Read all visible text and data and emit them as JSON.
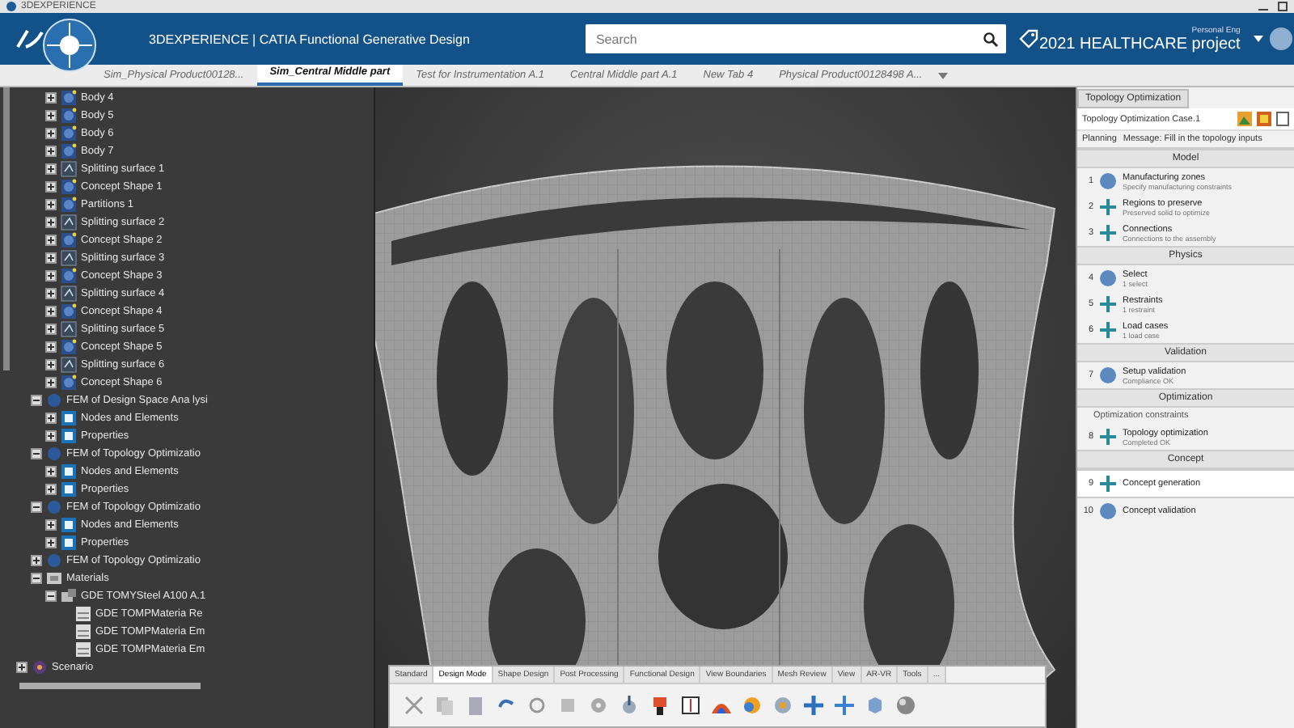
{
  "title_bar": {
    "title": "3DEXPERIENCE"
  },
  "header": {
    "app_title": "3DEXPERIENCE | CATIA Functional Generative Design",
    "search": {
      "placeholder": "Search"
    },
    "role": "Personal Eng",
    "project": "2021 HEALTHCARE project"
  },
  "tabs": [
    {
      "label": "Sim_Physical Product00128...",
      "selected": false
    },
    {
      "label": "Sim_Central Middle part",
      "selected": true
    },
    {
      "label": "Test for Instrumentation A.1",
      "selected": false
    },
    {
      "label": "Central Middle part A.1",
      "selected": false
    },
    {
      "label": "New Tab 4",
      "selected": false
    },
    {
      "label": "Physical Product00128498 A...",
      "selected": false
    }
  ],
  "tree": {
    "items": [
      {
        "children": [
          {
            "children": [
              {
                "label": "Body 4",
                "kind": "body",
                "expanded": false
              },
              {
                "label": "Body 5",
                "kind": "body",
                "expanded": false
              },
              {
                "label": "Body 6",
                "kind": "body",
                "expanded": false
              },
              {
                "label": "Body 7",
                "kind": "body",
                "expanded": false
              },
              {
                "label": "Splitting surface 1",
                "kind": "surface",
                "expanded": false
              },
              {
                "label": "Concept Shape 1",
                "kind": "body",
                "expanded": false
              },
              {
                "label": "Partitions 1",
                "kind": "body",
                "expanded": false
              },
              {
                "label": "Splitting surface 2",
                "kind": "surface",
                "expanded": false
              },
              {
                "label": "Concept Shape 2",
                "kind": "body",
                "expanded": false
              },
              {
                "label": "Splitting surface 3",
                "kind": "surface",
                "expanded": false
              },
              {
                "label": "Concept Shape 3",
                "kind": "body",
                "expanded": false
              },
              {
                "label": "Splitting surface 4",
                "kind": "surface",
                "expanded": false
              },
              {
                "label": "Concept Shape 4",
                "kind": "body",
                "expanded": false
              },
              {
                "label": "Splitting surface 5",
                "kind": "surface",
                "expanded": false
              },
              {
                "label": "Concept Shape 5",
                "kind": "body",
                "expanded": false
              },
              {
                "label": "Splitting surface 6",
                "kind": "surface",
                "expanded": false
              },
              {
                "label": "Concept Shape 6",
                "kind": "body",
                "expanded": false
              }
            ]
          },
          {
            "label": "FEM of Design Space Ana lysi",
            "kind": "fem",
            "expanded": true,
            "children": [
              {
                "label": "Nodes and Elements",
                "kind": "mesh",
                "expanded": false
              },
              {
                "label": "Properties",
                "kind": "mesh",
                "expanded": false
              }
            ]
          },
          {
            "label": "FEM of Topology Optimizatio",
            "kind": "fem",
            "expanded": true,
            "children": [
              {
                "label": "Nodes and Elements",
                "kind": "mesh",
                "expanded": false
              },
              {
                "label": "Properties",
                "kind": "mesh",
                "expanded": false
              }
            ]
          },
          {
            "label": "FEM of Topology Optimizatio",
            "kind": "fem",
            "expanded": true,
            "children": [
              {
                "label": "Nodes and Elements",
                "kind": "mesh",
                "expanded": false
              },
              {
                "label": "Properties",
                "kind": "mesh",
                "expanded": false
              }
            ]
          },
          {
            "label": "FEM of Topology Optimizatio",
            "kind": "fem",
            "expanded": false
          },
          {
            "label": "Materials",
            "kind": "materials",
            "expanded": true,
            "children": [
              {
                "label": "GDE TOMYSteel A100 A.1",
                "kind": "material",
                "expanded": true,
                "children": [
                  {
                    "label": "GDE TOMPMateria Re",
                    "kind": "material-item"
                  },
                  {
                    "label": "GDE TOMPMateria Em",
                    "kind": "material-item"
                  },
                  {
                    "label": "GDE TOMPMateria Em",
                    "kind": "material-item"
                  }
                ]
              }
            ]
          }
        ]
      },
      {
        "label": "Scenario",
        "kind": "scenario",
        "expanded": false
      }
    ]
  },
  "panel": {
    "title": "Topology Optimization",
    "case": "Topology Optimization Case.1",
    "planning": "Planning",
    "message": "Message: Fill in the topology inputs",
    "sections": [
      {
        "title": "Model",
        "steps": [
          {
            "kind": "step",
            "number": "1",
            "label": "Manufacturing zones",
            "status": "Specify manufacturing constraints",
            "selected": false
          },
          {
            "kind": "step",
            "number": "2",
            "label": "Regions to preserve",
            "status": "Preserved solid to optimize",
            "selected": false
          },
          {
            "kind": "step",
            "number": "3",
            "label": "Connections",
            "status": "Connections to the assembly",
            "selected": false
          }
        ]
      },
      {
        "title": "Physics",
        "steps": [
          {
            "kind": "step",
            "number": "4",
            "label": "Select",
            "status": "1 select",
            "selected": false
          },
          {
            "kind": "step",
            "number": "5",
            "label": "Restraints",
            "status": "1 restraint",
            "selected": false
          },
          {
            "kind": "step",
            "number": "6",
            "label": "Load cases",
            "status": "1 load case",
            "selected": false
          }
        ]
      },
      {
        "title": "Validation",
        "steps": [
          {
            "kind": "step",
            "number": "7",
            "label": "Setup validation",
            "status": "Compliance OK",
            "selected": false
          }
        ]
      },
      {
        "title": "Optimization",
        "steps": [
          {
            "kind": "add",
            "label": "Optimization constraints"
          },
          {
            "kind": "step",
            "number": "8",
            "label": "Topology optimization",
            "status": "Completed OK",
            "selected": false
          }
        ]
      },
      {
        "title": "Concept",
        "steps": [
          {
            "kind": "step",
            "number": "9",
            "label": "Concept generation",
            "selected": true
          },
          {
            "kind": "step",
            "number": "10",
            "label": "Concept validation",
            "selected": false
          }
        ]
      }
    ]
  },
  "toolbar": {
    "tabs": [
      {
        "label": "Standard",
        "selected": false
      },
      {
        "label": "Design Mode",
        "selected": true
      },
      {
        "label": "Shape Design",
        "selected": false
      },
      {
        "label": "Post Processing",
        "selected": false
      },
      {
        "label": "Functional Design",
        "selected": false
      },
      {
        "label": "View Boundaries",
        "selected": false
      },
      {
        "label": "Mesh Review",
        "selected": false
      },
      {
        "label": "View",
        "selected": false
      },
      {
        "label": "AR-VR",
        "selected": false
      },
      {
        "label": "Tools",
        "selected": false
      },
      {
        "label": "...",
        "selected": false
      }
    ]
  }
}
